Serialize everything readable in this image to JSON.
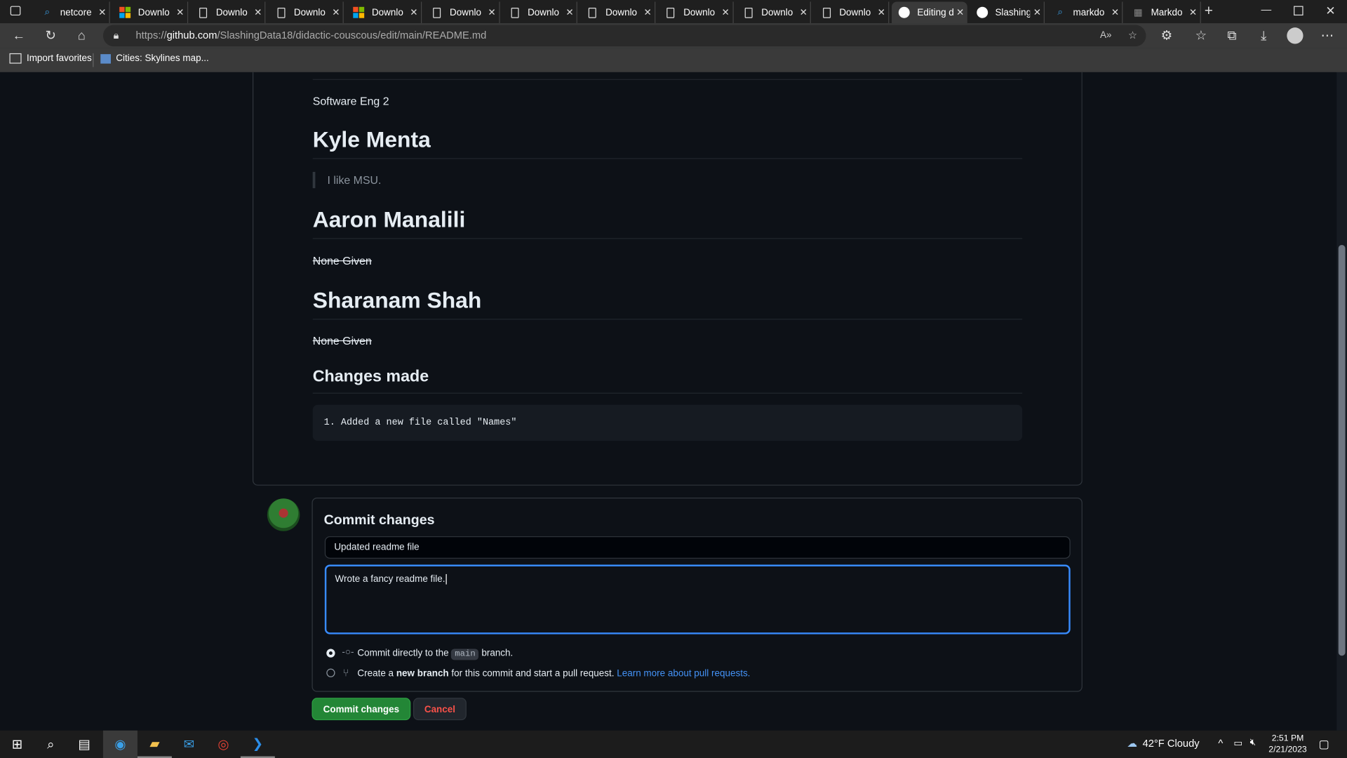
{
  "browser": {
    "tabs": [
      {
        "icon": "search-icon",
        "label": "netcore"
      },
      {
        "icon": "microsoft-icon",
        "label": "Downlo"
      },
      {
        "icon": "file-icon",
        "label": "Downlo"
      },
      {
        "icon": "file-icon",
        "label": "Downlo"
      },
      {
        "icon": "microsoft-icon",
        "label": "Downlo"
      },
      {
        "icon": "file-icon",
        "label": "Downlo"
      },
      {
        "icon": "file-icon",
        "label": "Downlo"
      },
      {
        "icon": "file-icon",
        "label": "Downlo"
      },
      {
        "icon": "file-icon",
        "label": "Downlo"
      },
      {
        "icon": "file-icon",
        "label": "Downlo"
      },
      {
        "icon": "file-icon",
        "label": "Downlo"
      },
      {
        "icon": "github-icon",
        "label": "Editing d",
        "active": true
      },
      {
        "icon": "github-icon",
        "label": "Slashing"
      },
      {
        "icon": "search-icon",
        "label": "markdo"
      },
      {
        "icon": "page-icon",
        "label": "Markdo"
      }
    ],
    "url_prefix": "https://",
    "url_domain": "github.com",
    "url_path": "/SlashingData18/didactic-couscous/edit/main/README.md",
    "favorites": [
      {
        "label": "Import favorites"
      },
      {
        "label": "Cities: Skylines map..."
      }
    ]
  },
  "readme": {
    "intro": "Software Eng 2",
    "sections": [
      {
        "heading": "Kyle Menta",
        "quote": "I like MSU."
      },
      {
        "heading": "Aaron Manalili",
        "text": "None Given"
      },
      {
        "heading": "Sharanam Shah",
        "text": "None Given"
      }
    ],
    "changes_heading": "Changes made",
    "changes_code": "1. Added a new file called \"Names\""
  },
  "commit": {
    "title": "Commit changes",
    "summary_value": "Updated readme file",
    "description_value": "Wrote a fancy readme file.",
    "option_direct_pre": "Commit directly to the",
    "option_direct_branch": "main",
    "option_direct_post": "branch.",
    "option_new_pre": "Create a",
    "option_new_bold": "new branch",
    "option_new_post": "for this commit and start a pull request.",
    "option_new_link": "Learn more about pull requests.",
    "selected": "direct",
    "commit_button": "Commit changes",
    "cancel_button": "Cancel"
  },
  "taskbar": {
    "weather": "42°F  Cloudy",
    "time": "2:51 PM",
    "date": "2/21/2023"
  },
  "colors": {
    "accent": "#238636",
    "link": "#4493f8",
    "danger": "#f85149",
    "focus": "#388bfd"
  }
}
